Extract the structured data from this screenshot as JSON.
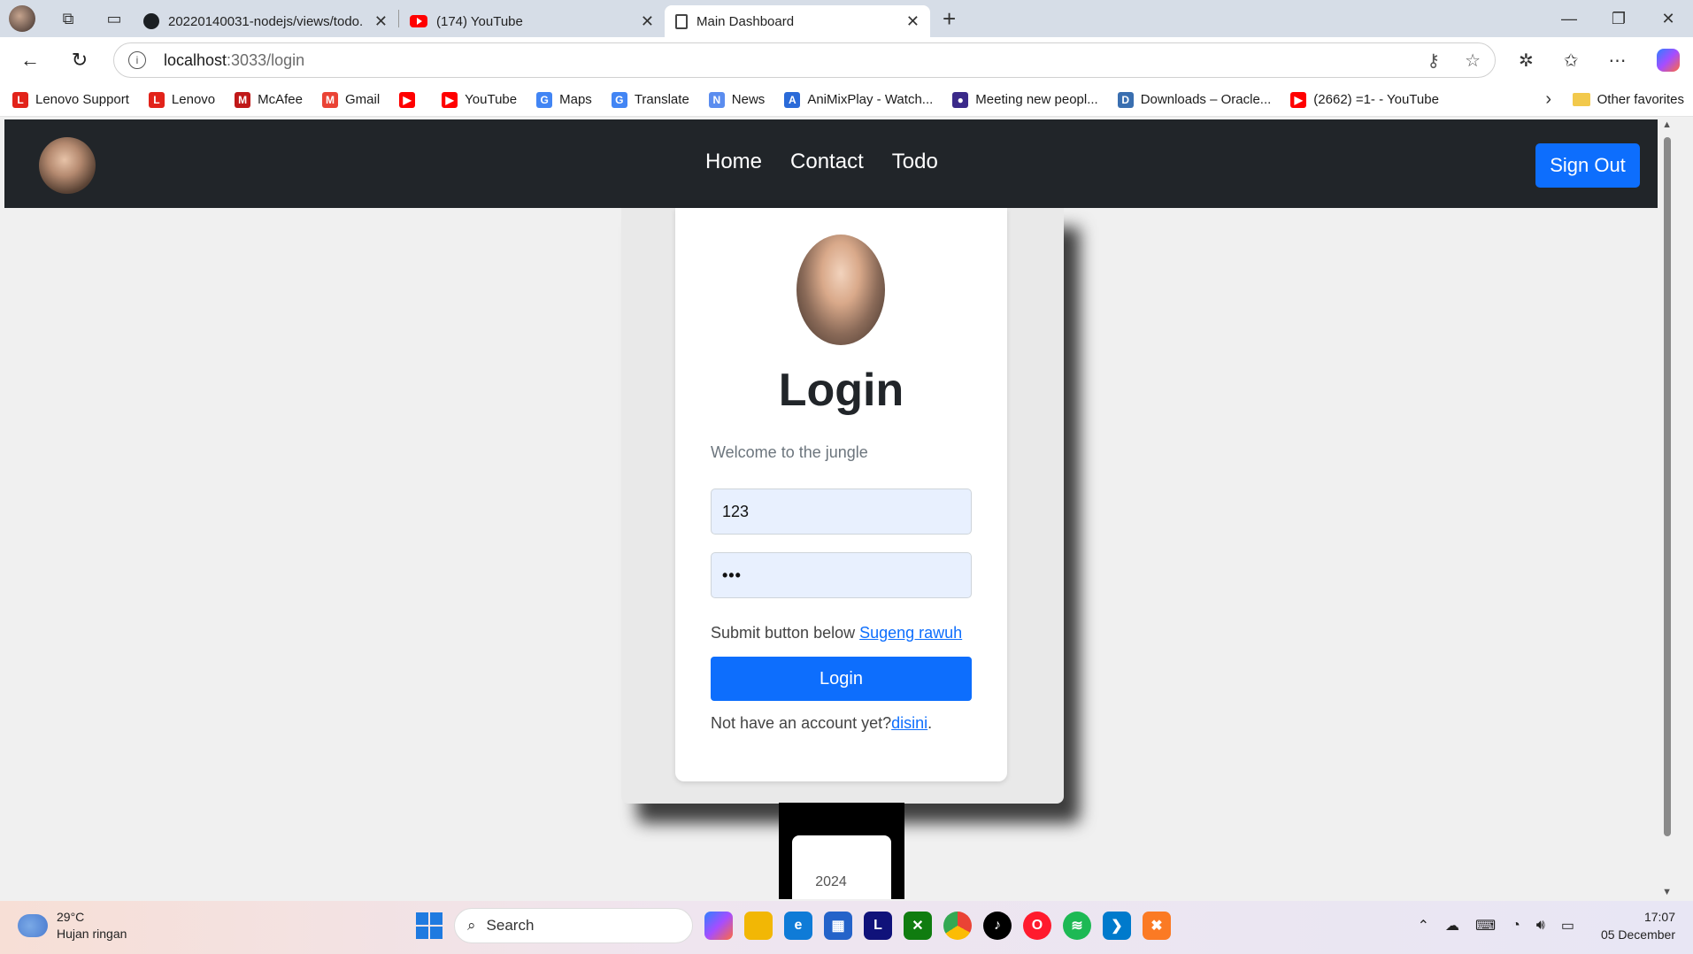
{
  "browser": {
    "tabs": [
      {
        "title": "20220140031-nodejs/views/todo.",
        "icon": "github-icon",
        "active": false
      },
      {
        "title": "(174) YouTube",
        "icon": "youtube-icon",
        "active": false
      },
      {
        "title": "Main Dashboard",
        "icon": "document-icon",
        "active": true
      }
    ],
    "url_host": "localhost",
    "url_path": ":3033/login",
    "bookmarks": [
      {
        "label": "Lenovo Support",
        "color": "#e2231a",
        "glyph": "L"
      },
      {
        "label": "Lenovo",
        "color": "#e2231a",
        "glyph": "L"
      },
      {
        "label": "McAfee",
        "color": "#c01818",
        "glyph": "M"
      },
      {
        "label": "Gmail",
        "color": "#ea4335",
        "glyph": "M"
      },
      {
        "label": "",
        "color": "#ff0000",
        "glyph": "▶"
      },
      {
        "label": "YouTube",
        "color": "#ff0000",
        "glyph": "▶"
      },
      {
        "label": "Maps",
        "color": "#4285f4",
        "glyph": "G"
      },
      {
        "label": "Translate",
        "color": "#4285f4",
        "glyph": "G"
      },
      {
        "label": "News",
        "color": "#5b8def",
        "glyph": "N"
      },
      {
        "label": "AniMixPlay - Watch...",
        "color": "#2a6ad8",
        "glyph": "A"
      },
      {
        "label": "Meeting new peopl...",
        "color": "#3b2a8a",
        "glyph": "●"
      },
      {
        "label": "Downloads – Oracle...",
        "color": "#3a6fb0",
        "glyph": "D"
      },
      {
        "label": "(2662) =1- - YouTube",
        "color": "#ff0000",
        "glyph": "▶"
      }
    ],
    "other_favorites": "Other favorites"
  },
  "site": {
    "nav_links": [
      "Home",
      "Contact",
      "Todo"
    ],
    "signout_label": "Sign Out",
    "login_title": "Login",
    "welcome": "Welcome to the jungle",
    "username_value": "123",
    "password_value": "•••",
    "submit_text": "Submit button below ",
    "submit_link": "Sugeng rawuh",
    "login_button": "Login",
    "signup_text": "Not have an account yet?",
    "signup_link": "disini",
    "signup_end": ".",
    "footer_year": "2024",
    "accent": "#0d6efd",
    "nav_bg": "#212529"
  },
  "taskbar": {
    "temperature": "29°C",
    "weather": "Hujan ringan",
    "search_placeholder": "Search",
    "time": "17:07",
    "date": "05 December"
  }
}
